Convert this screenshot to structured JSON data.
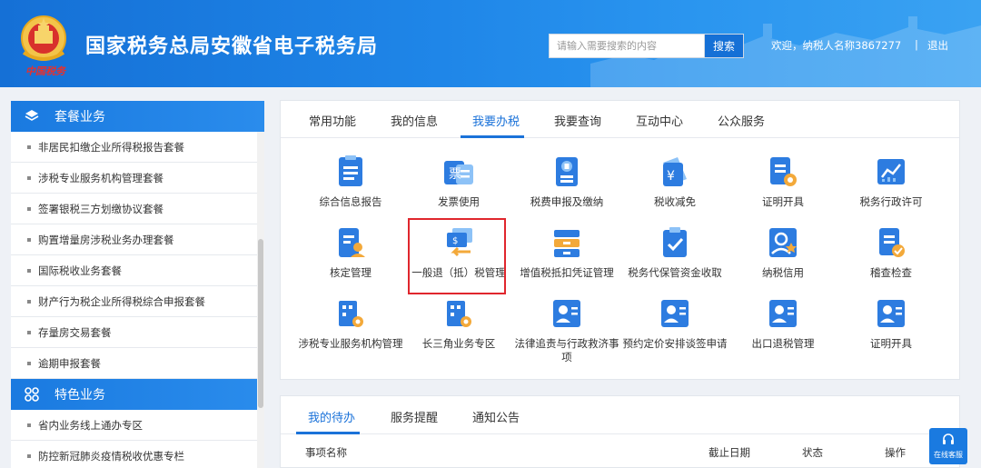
{
  "header": {
    "title": "国家税务总局安徽省电子税务局",
    "brush_text": "中国税务",
    "search_placeholder": "请输入需要搜索的内容",
    "search_button": "搜索",
    "welcome": "欢迎，纳税人名称3867277",
    "separator": "|",
    "logout": "退出"
  },
  "sidebar": {
    "group1_title": "套餐业务",
    "group1_items": [
      "非居民扣缴企业所得税报告套餐",
      "涉税专业服务机构管理套餐",
      "签署银税三方划缴协议套餐",
      "购置增量房涉税业务办理套餐",
      "国际税收业务套餐",
      "财产行为税企业所得税综合申报套餐",
      "存量房交易套餐",
      "逾期申报套餐"
    ],
    "group2_title": "特色业务",
    "group2_items": [
      "省内业务线上通办专区",
      "防控新冠肺炎疫情税收优惠专栏"
    ]
  },
  "main": {
    "tabs": [
      "常用功能",
      "我的信息",
      "我要办税",
      "我要查询",
      "互动中心",
      "公众服务"
    ],
    "active_tab": "我要办税",
    "tiles": [
      "综合信息报告",
      "发票使用",
      "税费申报及缴纳",
      "税收减免",
      "证明开具",
      "税务行政许可",
      "核定管理",
      "一般退（抵）税管理",
      "增值税抵扣凭证管理",
      "税务代保管资金收取",
      "纳税信用",
      "稽查检查",
      "涉税专业服务机构管理",
      "长三角业务专区",
      "法律追责与行政救济事项",
      "预约定价安排谈签申请",
      "出口退税管理",
      "证明开具"
    ],
    "highlighted_tile": "一般退（抵）税管理"
  },
  "bottom": {
    "tabs": [
      "我的待办",
      "服务提醒",
      "通知公告"
    ],
    "active_tab": "我的待办",
    "columns": [
      "事项名称",
      "截止日期",
      "状态",
      "操作"
    ]
  },
  "online_service": "在线客服",
  "colors": {
    "primary": "#1a72d9",
    "header": "#1f86e8",
    "highlight": "#e0262d"
  }
}
